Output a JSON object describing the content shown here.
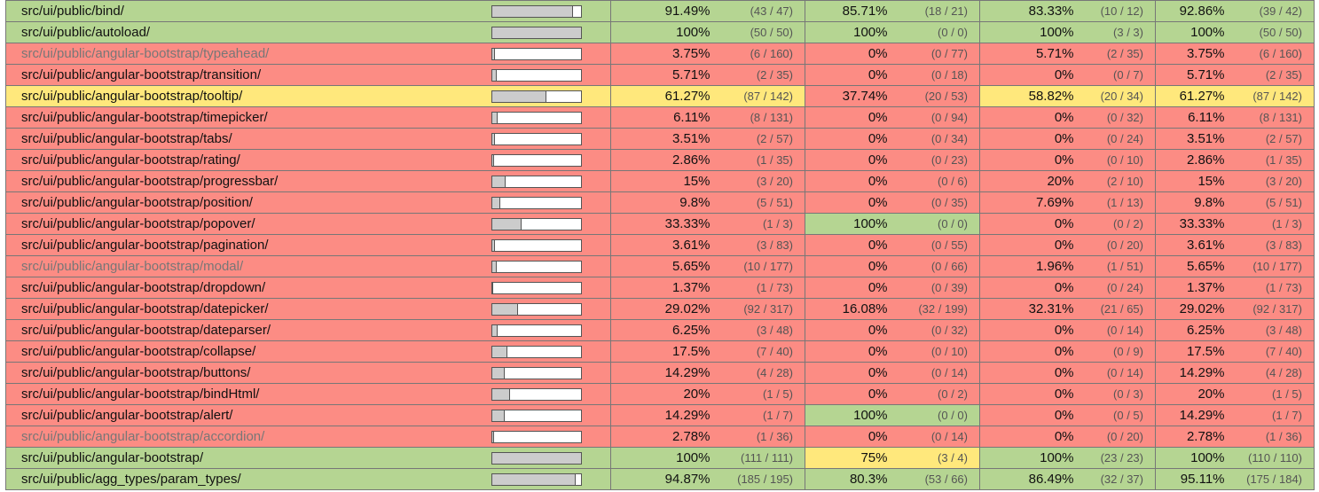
{
  "colors": {
    "high": "#b5d592",
    "medium": "#ffe87c",
    "low": "#fc8c84"
  },
  "rows": [
    {
      "file": "src/ui/public/bind/",
      "visited": false,
      "cells": [
        [
          "91.49%",
          "(43 / 47)",
          "high"
        ],
        [
          "85.71%",
          "(18 / 21)",
          "high"
        ],
        [
          "83.33%",
          "(10 / 12)",
          "high"
        ],
        [
          "92.86%",
          "(39 / 42)",
          "high"
        ]
      ],
      "coverage": 91.49
    },
    {
      "file": "src/ui/public/autoload/",
      "visited": false,
      "cells": [
        [
          "100%",
          "(50 / 50)",
          "high"
        ],
        [
          "100%",
          "(0 / 0)",
          "high"
        ],
        [
          "100%",
          "(3 / 3)",
          "high"
        ],
        [
          "100%",
          "(50 / 50)",
          "high"
        ]
      ],
      "coverage": 100
    },
    {
      "file": "src/ui/public/angular-bootstrap/typeahead/",
      "visited": true,
      "cells": [
        [
          "3.75%",
          "(6 / 160)",
          "low"
        ],
        [
          "0%",
          "(0 / 77)",
          "low"
        ],
        [
          "5.71%",
          "(2 / 35)",
          "low"
        ],
        [
          "3.75%",
          "(6 / 160)",
          "low"
        ]
      ],
      "coverage": 3.75
    },
    {
      "file": "src/ui/public/angular-bootstrap/transition/",
      "visited": false,
      "cells": [
        [
          "5.71%",
          "(2 / 35)",
          "low"
        ],
        [
          "0%",
          "(0 / 18)",
          "low"
        ],
        [
          "0%",
          "(0 / 7)",
          "low"
        ],
        [
          "5.71%",
          "(2 / 35)",
          "low"
        ]
      ],
      "coverage": 5.71
    },
    {
      "file": "src/ui/public/angular-bootstrap/tooltip/",
      "visited": false,
      "cells": [
        [
          "61.27%",
          "(87 / 142)",
          "medium"
        ],
        [
          "37.74%",
          "(20 / 53)",
          "low"
        ],
        [
          "58.82%",
          "(20 / 34)",
          "medium"
        ],
        [
          "61.27%",
          "(87 / 142)",
          "medium"
        ]
      ],
      "coverage": 61.27
    },
    {
      "file": "src/ui/public/angular-bootstrap/timepicker/",
      "visited": false,
      "cells": [
        [
          "6.11%",
          "(8 / 131)",
          "low"
        ],
        [
          "0%",
          "(0 / 94)",
          "low"
        ],
        [
          "0%",
          "(0 / 32)",
          "low"
        ],
        [
          "6.11%",
          "(8 / 131)",
          "low"
        ]
      ],
      "coverage": 6.11
    },
    {
      "file": "src/ui/public/angular-bootstrap/tabs/",
      "visited": false,
      "cells": [
        [
          "3.51%",
          "(2 / 57)",
          "low"
        ],
        [
          "0%",
          "(0 / 34)",
          "low"
        ],
        [
          "0%",
          "(0 / 24)",
          "low"
        ],
        [
          "3.51%",
          "(2 / 57)",
          "low"
        ]
      ],
      "coverage": 3.51
    },
    {
      "file": "src/ui/public/angular-bootstrap/rating/",
      "visited": false,
      "cells": [
        [
          "2.86%",
          "(1 / 35)",
          "low"
        ],
        [
          "0%",
          "(0 / 23)",
          "low"
        ],
        [
          "0%",
          "(0 / 10)",
          "low"
        ],
        [
          "2.86%",
          "(1 / 35)",
          "low"
        ]
      ],
      "coverage": 2.86
    },
    {
      "file": "src/ui/public/angular-bootstrap/progressbar/",
      "visited": false,
      "cells": [
        [
          "15%",
          "(3 / 20)",
          "low"
        ],
        [
          "0%",
          "(0 / 6)",
          "low"
        ],
        [
          "20%",
          "(2 / 10)",
          "low"
        ],
        [
          "15%",
          "(3 / 20)",
          "low"
        ]
      ],
      "coverage": 15
    },
    {
      "file": "src/ui/public/angular-bootstrap/position/",
      "visited": false,
      "cells": [
        [
          "9.8%",
          "(5 / 51)",
          "low"
        ],
        [
          "0%",
          "(0 / 35)",
          "low"
        ],
        [
          "7.69%",
          "(1 / 13)",
          "low"
        ],
        [
          "9.8%",
          "(5 / 51)",
          "low"
        ]
      ],
      "coverage": 9.8
    },
    {
      "file": "src/ui/public/angular-bootstrap/popover/",
      "visited": false,
      "cells": [
        [
          "33.33%",
          "(1 / 3)",
          "low"
        ],
        [
          "100%",
          "(0 / 0)",
          "high"
        ],
        [
          "0%",
          "(0 / 2)",
          "low"
        ],
        [
          "33.33%",
          "(1 / 3)",
          "low"
        ]
      ],
      "coverage": 33.33
    },
    {
      "file": "src/ui/public/angular-bootstrap/pagination/",
      "visited": false,
      "cells": [
        [
          "3.61%",
          "(3 / 83)",
          "low"
        ],
        [
          "0%",
          "(0 / 55)",
          "low"
        ],
        [
          "0%",
          "(0 / 20)",
          "low"
        ],
        [
          "3.61%",
          "(3 / 83)",
          "low"
        ]
      ],
      "coverage": 3.61
    },
    {
      "file": "src/ui/public/angular-bootstrap/modal/",
      "visited": true,
      "cells": [
        [
          "5.65%",
          "(10 / 177)",
          "low"
        ],
        [
          "0%",
          "(0 / 66)",
          "low"
        ],
        [
          "1.96%",
          "(1 / 51)",
          "low"
        ],
        [
          "5.65%",
          "(10 / 177)",
          "low"
        ]
      ],
      "coverage": 5.65
    },
    {
      "file": "src/ui/public/angular-bootstrap/dropdown/",
      "visited": false,
      "cells": [
        [
          "1.37%",
          "(1 / 73)",
          "low"
        ],
        [
          "0%",
          "(0 / 39)",
          "low"
        ],
        [
          "0%",
          "(0 / 24)",
          "low"
        ],
        [
          "1.37%",
          "(1 / 73)",
          "low"
        ]
      ],
      "coverage": 1.37
    },
    {
      "file": "src/ui/public/angular-bootstrap/datepicker/",
      "visited": false,
      "cells": [
        [
          "29.02%",
          "(92 / 317)",
          "low"
        ],
        [
          "16.08%",
          "(32 / 199)",
          "low"
        ],
        [
          "32.31%",
          "(21 / 65)",
          "low"
        ],
        [
          "29.02%",
          "(92 / 317)",
          "low"
        ]
      ],
      "coverage": 29.02
    },
    {
      "file": "src/ui/public/angular-bootstrap/dateparser/",
      "visited": false,
      "cells": [
        [
          "6.25%",
          "(3 / 48)",
          "low"
        ],
        [
          "0%",
          "(0 / 32)",
          "low"
        ],
        [
          "0%",
          "(0 / 14)",
          "low"
        ],
        [
          "6.25%",
          "(3 / 48)",
          "low"
        ]
      ],
      "coverage": 6.25
    },
    {
      "file": "src/ui/public/angular-bootstrap/collapse/",
      "visited": false,
      "cells": [
        [
          "17.5%",
          "(7 / 40)",
          "low"
        ],
        [
          "0%",
          "(0 / 10)",
          "low"
        ],
        [
          "0%",
          "(0 / 9)",
          "low"
        ],
        [
          "17.5%",
          "(7 / 40)",
          "low"
        ]
      ],
      "coverage": 17.5
    },
    {
      "file": "src/ui/public/angular-bootstrap/buttons/",
      "visited": false,
      "cells": [
        [
          "14.29%",
          "(4 / 28)",
          "low"
        ],
        [
          "0%",
          "(0 / 14)",
          "low"
        ],
        [
          "0%",
          "(0 / 14)",
          "low"
        ],
        [
          "14.29%",
          "(4 / 28)",
          "low"
        ]
      ],
      "coverage": 14.29
    },
    {
      "file": "src/ui/public/angular-bootstrap/bindHtml/",
      "visited": false,
      "cells": [
        [
          "20%",
          "(1 / 5)",
          "low"
        ],
        [
          "0%",
          "(0 / 2)",
          "low"
        ],
        [
          "0%",
          "(0 / 3)",
          "low"
        ],
        [
          "20%",
          "(1 / 5)",
          "low"
        ]
      ],
      "coverage": 20
    },
    {
      "file": "src/ui/public/angular-bootstrap/alert/",
      "visited": false,
      "cells": [
        [
          "14.29%",
          "(1 / 7)",
          "low"
        ],
        [
          "100%",
          "(0 / 0)",
          "high"
        ],
        [
          "0%",
          "(0 / 5)",
          "low"
        ],
        [
          "14.29%",
          "(1 / 7)",
          "low"
        ]
      ],
      "coverage": 14.29
    },
    {
      "file": "src/ui/public/angular-bootstrap/accordion/",
      "visited": true,
      "cells": [
        [
          "2.78%",
          "(1 / 36)",
          "low"
        ],
        [
          "0%",
          "(0 / 14)",
          "low"
        ],
        [
          "0%",
          "(0 / 20)",
          "low"
        ],
        [
          "2.78%",
          "(1 / 36)",
          "low"
        ]
      ],
      "coverage": 2.78
    },
    {
      "file": "src/ui/public/angular-bootstrap/",
      "visited": false,
      "cells": [
        [
          "100%",
          "(111 / 111)",
          "high"
        ],
        [
          "75%",
          "(3 / 4)",
          "medium"
        ],
        [
          "100%",
          "(23 / 23)",
          "high"
        ],
        [
          "100%",
          "(110 / 110)",
          "high"
        ]
      ],
      "coverage": 100
    },
    {
      "file": "src/ui/public/agg_types/param_types/",
      "visited": false,
      "cells": [
        [
          "94.87%",
          "(185 / 195)",
          "high"
        ],
        [
          "80.3%",
          "(53 / 66)",
          "high"
        ],
        [
          "86.49%",
          "(32 / 37)",
          "high"
        ],
        [
          "95.11%",
          "(175 / 184)",
          "high"
        ]
      ],
      "coverage": 94.87
    }
  ]
}
